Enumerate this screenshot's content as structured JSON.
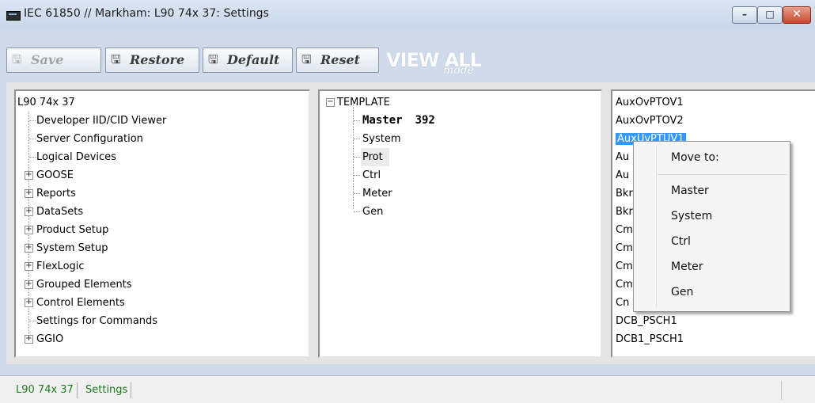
{
  "window": {
    "title": "IEC 61850 // Markham: L90 74x 37: Settings"
  },
  "toolbar": {
    "save_label": "Save",
    "restore_label": "Restore",
    "default_label": "Default",
    "reset_label": "Reset",
    "view_all": "VIEW ALL",
    "view_mode": "mode"
  },
  "left_tree": {
    "root": "L90 74x 37",
    "items": [
      {
        "label": "Developer IID/CID Viewer",
        "expandable": false
      },
      {
        "label": "Server Configuration",
        "expandable": false
      },
      {
        "label": "Logical Devices",
        "expandable": false
      },
      {
        "label": "GOOSE",
        "expandable": true
      },
      {
        "label": "Reports",
        "expandable": true
      },
      {
        "label": "DataSets",
        "expandable": true
      },
      {
        "label": "Product Setup",
        "expandable": true
      },
      {
        "label": "System Setup",
        "expandable": true
      },
      {
        "label": "FlexLogic",
        "expandable": true
      },
      {
        "label": "Grouped Elements",
        "expandable": true
      },
      {
        "label": "Control Elements",
        "expandable": true
      },
      {
        "label": "Settings for Commands",
        "expandable": false
      },
      {
        "label": "GGIO",
        "expandable": true
      }
    ]
  },
  "mid_tree": {
    "root": "TEMPLATE",
    "items": [
      {
        "label": "Master",
        "count": "392",
        "bold": true
      },
      {
        "label": "System"
      },
      {
        "label": "Prot",
        "highlighted": true
      },
      {
        "label": "Ctrl"
      },
      {
        "label": "Meter"
      },
      {
        "label": "Gen"
      }
    ]
  },
  "right_list": {
    "items": [
      "AuxOvPTOV1",
      "AuxOvPTOV2",
      "AuxUvPTUV1",
      "Au",
      "Au",
      "Bkr",
      "Bkr",
      "Cm",
      "Cm",
      "Cm",
      "Cm",
      "Cn",
      "DCB_PSCH1",
      "DCB1_PSCH1"
    ],
    "selected_index": 2
  },
  "context_menu": {
    "header": "Move to:",
    "items": [
      "Master",
      "System",
      "Ctrl",
      "Meter",
      "Gen"
    ]
  },
  "status": {
    "device": "L90 74x 37",
    "mode": "Settings"
  }
}
